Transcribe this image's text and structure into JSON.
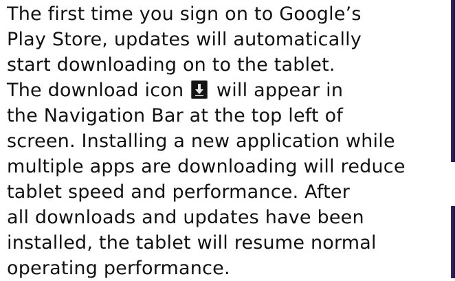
{
  "document": {
    "lines": [
      "The first time you sign on to Google’s",
      "Play Store, updates will automatically",
      "start downloading on to the tablet.",
      "The download icon",
      "will appear in",
      "the Navigation Bar at the top left of",
      "screen.  Installing a new application while",
      "multiple apps are downloading will reduce",
      "tablet speed and performance.  After",
      "all downloads and updates have been",
      "installed, the tablet will resume normal",
      "operating performance."
    ],
    "inline_icon": "download-icon"
  },
  "colors": {
    "text": "#111111",
    "icon_bg": "#141414",
    "edge": "#2a1e55"
  }
}
